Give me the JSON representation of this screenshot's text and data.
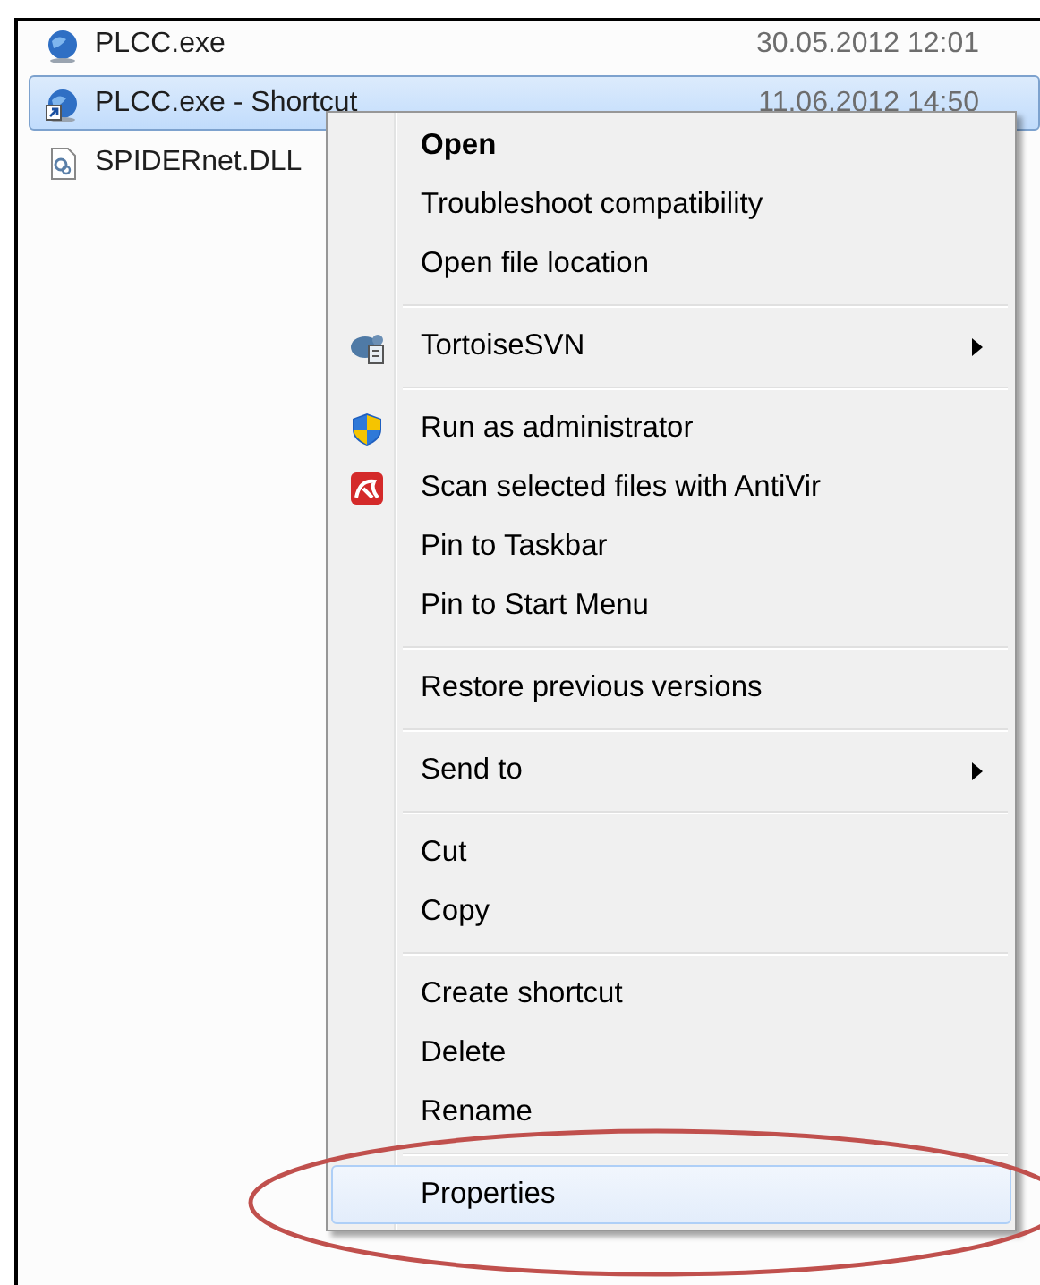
{
  "files": [
    {
      "name": "PLCC.exe",
      "date": "30.05.2012 12:01",
      "selected": false,
      "kind": "app"
    },
    {
      "name": "PLCC.exe - Shortcut",
      "date": "11.06.2012 14:50",
      "selected": true,
      "kind": "shortcut"
    },
    {
      "name": "SPIDERnet.DLL",
      "selected": false,
      "kind": "dll"
    }
  ],
  "context_menu": {
    "sections": [
      [
        {
          "label": "Open",
          "bold": true,
          "selected": false
        },
        {
          "label": "Troubleshoot compatibility",
          "selected": false
        },
        {
          "label": "Open file location",
          "selected": false
        }
      ],
      [
        {
          "label": "TortoiseSVN",
          "kind": "tortoise",
          "submenu": true,
          "selected": false
        }
      ],
      [
        {
          "label": "Run as administrator",
          "kind": "shield",
          "selected": false
        },
        {
          "label": "Scan selected files with AntiVir",
          "kind": "antivir",
          "selected": false
        },
        {
          "label": "Pin to Taskbar",
          "selected": false
        },
        {
          "label": "Pin to Start Menu",
          "selected": false
        }
      ],
      [
        {
          "label": "Restore previous versions",
          "selected": false
        }
      ],
      [
        {
          "label": "Send to",
          "submenu": true,
          "selected": false
        }
      ],
      [
        {
          "label": "Cut",
          "selected": false
        },
        {
          "label": "Copy",
          "selected": false
        }
      ],
      [
        {
          "label": "Create shortcut",
          "selected": false
        },
        {
          "label": "Delete",
          "selected": false
        },
        {
          "label": "Rename",
          "selected": false
        }
      ],
      [
        {
          "label": "Properties",
          "selected": true
        }
      ]
    ]
  }
}
